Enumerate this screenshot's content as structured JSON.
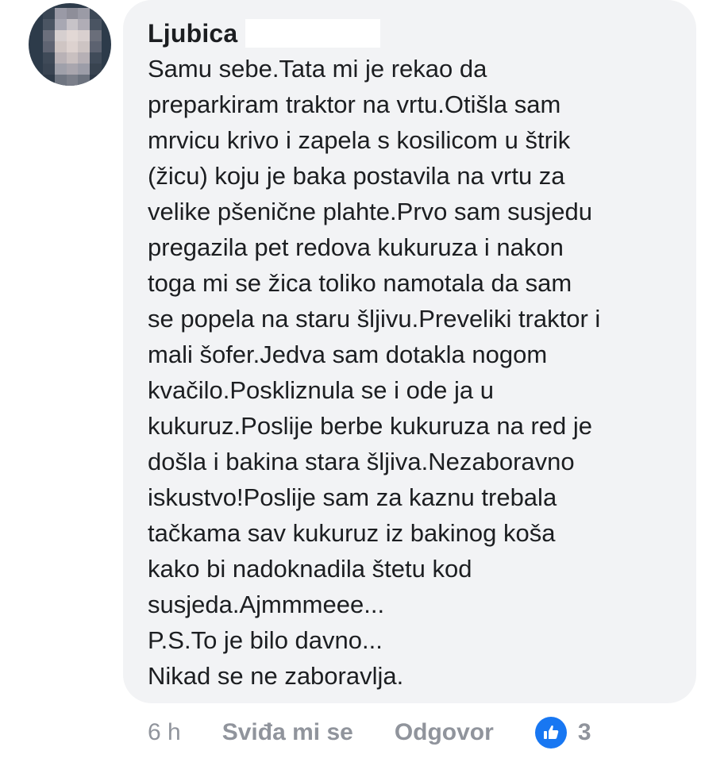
{
  "comment": {
    "author": "Ljubica",
    "text_lines": [
      "Samu sebe.Tata mi je rekao da",
      "preparkiram traktor na vrtu.Otišla sam",
      "mrvicu krivo i zapela s kosilicom u štrik",
      "(žicu) koju je baka postavila na vrtu za",
      "velike pšenične plahte.Prvo sam susjedu",
      "pregazila pet redova kukuruza i nakon",
      "toga mi se žica toliko namotala da sam",
      "se popela na staru šljivu.Preveliki traktor i",
      "mali šofer.Jedva sam dotakla nogom",
      "kvačilo.Poskliznula se i ode ja u",
      "kukuruz.Poslije berbe kukuruza na red je",
      "došla i bakina stara šljiva.Nezaboravno",
      "iskustvo!Poslije sam za kaznu trebala",
      "tačkama sav kukuruz iz bakinog koša",
      "kako bi nadoknadila štetu kod",
      "susjeda.Ajmmmeee...",
      "P.S.To je bilo davno...",
      "Nikad se ne zaboravlja."
    ]
  },
  "actions": {
    "timestamp": "6 h",
    "like_label": "Sviđa mi se",
    "reply_label": "Odgovor",
    "reaction_icon": "thumbs-up-icon",
    "reaction_count": "3"
  },
  "colors": {
    "bubble_background": "#f2f3f5",
    "text": "#1c1e21",
    "muted": "#90949c",
    "like_blue": "#1877f2"
  }
}
